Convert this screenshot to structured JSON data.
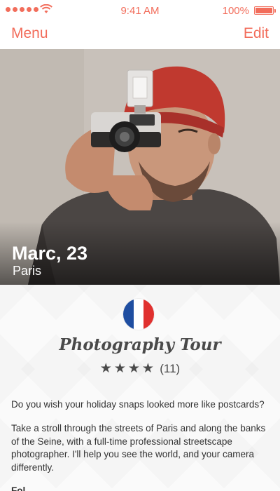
{
  "status_bar": {
    "time": "9:41 AM",
    "battery_percent": "100%",
    "signal_bars": 5
  },
  "nav": {
    "left_label": "Menu",
    "right_label": "Edit"
  },
  "hero": {
    "name": "Marc, 23",
    "city": "Paris"
  },
  "tour": {
    "flag_icon": "france-flag-icon",
    "flag_colors": [
      "#1f4ea1",
      "#ffffff",
      "#e0312f"
    ],
    "title": "Photography Tour",
    "stars": "★★★★",
    "rating_value": 4,
    "review_count": "(11)",
    "description_1": "Do you wish your holiday snaps looked more like postcards?",
    "description_2": "Take a stroll  through the streets of Paris and along the banks of the Seine, with a full-time professional streetscape photographer. I'll help you see the world, and your camera differently.",
    "description_3": "Fol"
  },
  "colors": {
    "accent": "#f26d5b",
    "text": "#333333"
  }
}
